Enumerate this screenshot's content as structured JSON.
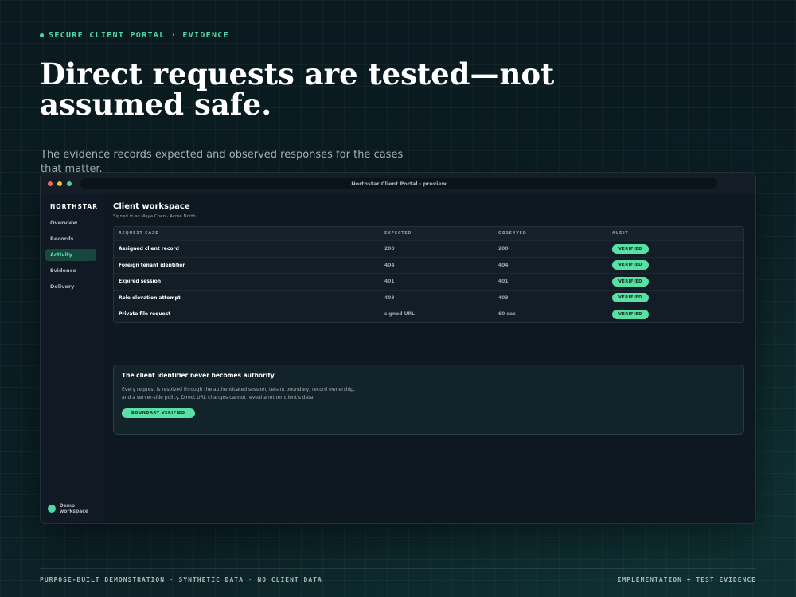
{
  "eyebrow": "SECURE CLIENT PORTAL · EVIDENCE",
  "hero": {
    "title": "Direct requests are tested—not assumed safe.",
    "subtitle": "The evidence records expected and observed responses for the cases that matter."
  },
  "window": {
    "url": "Northstar Client Portal · preview"
  },
  "sidebar": {
    "brand": "NORTHSTAR",
    "items": [
      {
        "label": "Overview"
      },
      {
        "label": "Records"
      },
      {
        "label": "Activity",
        "active": true
      },
      {
        "label": "Evidence"
      },
      {
        "label": "Delivery"
      }
    ],
    "footer": "Demo workspace"
  },
  "main": {
    "title": "Client workspace",
    "signed_in": "Signed in as Maya Chen · Acme North",
    "table": {
      "headers": [
        "REQUEST CASE",
        "EXPECTED",
        "OBSERVED",
        "AUDIT"
      ],
      "rows": [
        {
          "case": "Assigned client record",
          "expected": "200",
          "observed": "200",
          "audit": "VERIFIED"
        },
        {
          "case": "Foreign tenant identifier",
          "expected": "404",
          "observed": "404",
          "audit": "VERIFIED"
        },
        {
          "case": "Expired session",
          "expected": "401",
          "observed": "401",
          "audit": "VERIFIED"
        },
        {
          "case": "Role elevation attempt",
          "expected": "403",
          "observed": "403",
          "audit": "VERIFIED"
        },
        {
          "case": "Private file request",
          "expected": "signed URL",
          "observed": "60 sec",
          "audit": "VERIFIED"
        }
      ]
    },
    "card": {
      "title": "The client identifier never becomes authority",
      "body": "Every request is resolved through the authenticated session, tenant boundary, record ownership, and a server-side policy. Direct URL changes cannot reveal another client's data.",
      "badge": "BOUNDARY VERIFIED"
    }
  },
  "footer": {
    "left": "PURPOSE-BUILT DEMONSTRATION · SYNTHETIC DATA · NO CLIENT DATA",
    "right": "IMPLEMENTATION + TEST EVIDENCE"
  },
  "colors": {
    "accent": "#4fd8a8",
    "badge": "#5ae0a4",
    "background": "#0a1a1f"
  }
}
